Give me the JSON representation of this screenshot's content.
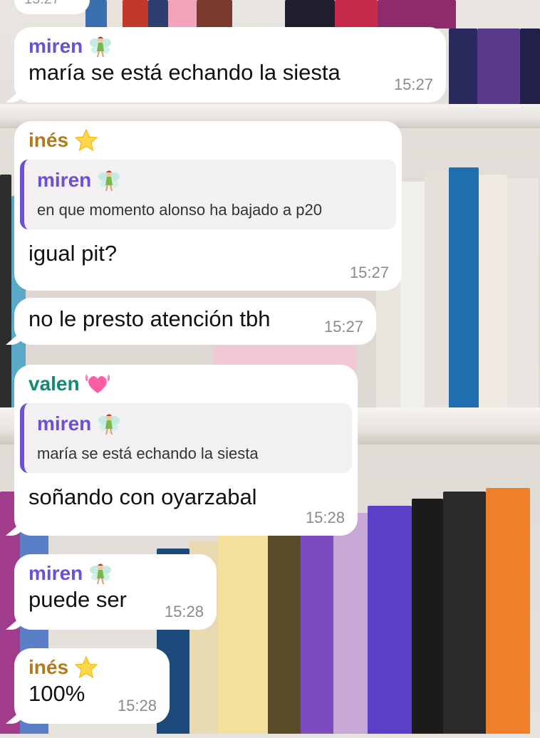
{
  "colors": {
    "miren": "#6b4fd6",
    "ines": "#b07a1e",
    "valen": "#138a72",
    "quote_bar": "#6b4fd6",
    "bubble": "#ffffff",
    "time": "#8a8a8a"
  },
  "top_stub_time": "15:27",
  "messages": [
    {
      "sender": "miren",
      "sender_emoji": "fairy-emoji",
      "text": "maría se está echando la siesta",
      "time": "15:27"
    },
    {
      "sender": "inés",
      "sender_emoji": "star-emoji",
      "reply": {
        "sender": "miren",
        "sender_emoji": "fairy-emoji",
        "text": "en que momento alonso ha bajado a p20"
      },
      "text": "igual pit?",
      "time": "15:27"
    },
    {
      "text": "no le presto atención tbh",
      "time": "15:27"
    },
    {
      "sender": "valen",
      "sender_emoji": "heart-emoji",
      "reply": {
        "sender": "miren",
        "sender_emoji": "fairy-emoji",
        "text": "maría se está echando la siesta"
      },
      "text": "soñando con oyarzabal",
      "time": "15:28"
    },
    {
      "sender": "miren",
      "sender_emoji": "fairy-emoji",
      "text": "puede ser",
      "time": "15:28"
    },
    {
      "sender": "inés",
      "sender_emoji": "star-emoji",
      "text": "100%",
      "time": "15:28"
    }
  ]
}
